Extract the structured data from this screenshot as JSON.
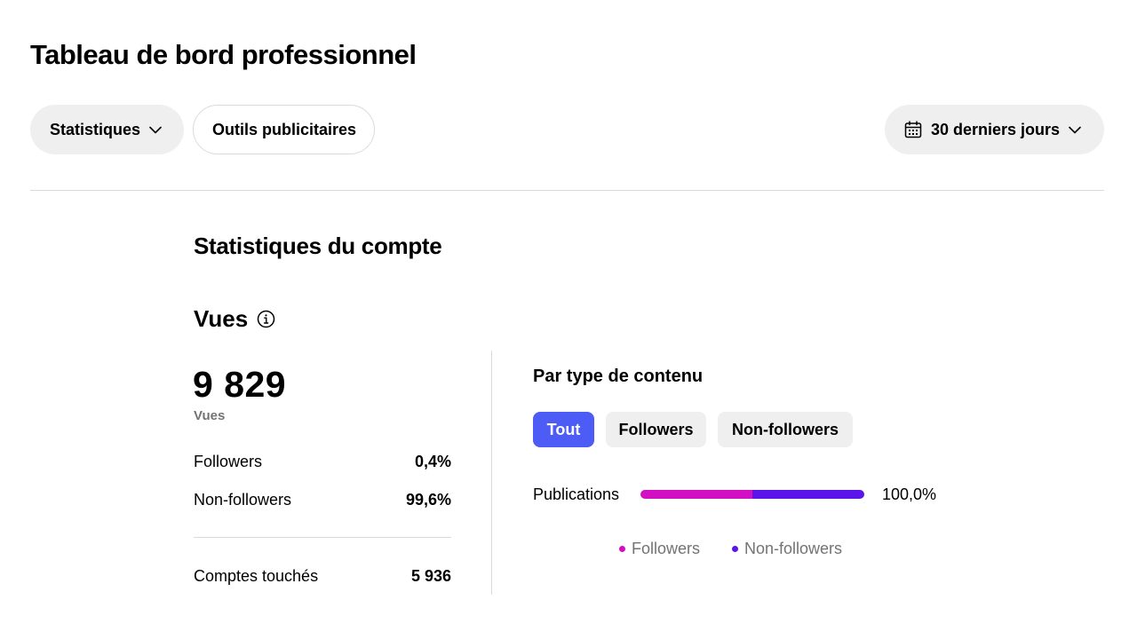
{
  "header": {
    "title": "Tableau de bord professionnel"
  },
  "toolbar": {
    "stats_label": "Statistiques",
    "tools_label": "Outils publicitaires",
    "range_label": "30 derniers jours"
  },
  "main": {
    "section_title": "Statistiques du compte",
    "metric_title": "Vues",
    "total_value": "9 829",
    "total_label": "Vues",
    "rows": [
      {
        "label": "Followers",
        "value": "0,4%"
      },
      {
        "label": "Non-followers",
        "value": "99,6%"
      },
      {
        "label": "Comptes touchés",
        "value": "5 936"
      }
    ]
  },
  "content_type": {
    "title": "Par type de contenu",
    "tabs": [
      {
        "label": "Tout",
        "selected": true
      },
      {
        "label": "Followers",
        "selected": false
      },
      {
        "label": "Non-followers",
        "selected": false
      }
    ],
    "bar": {
      "label": "Publications",
      "value": "100,0%",
      "followers_share": 0.5,
      "nonfollowers_share": 0.5
    },
    "legend": [
      {
        "label": "Followers",
        "color": "#d30fc4"
      },
      {
        "label": "Non-followers",
        "color": "#5b14ea"
      }
    ]
  },
  "colors": {
    "accent": "#4c5cf5",
    "followers": "#d30fc4",
    "nonfollowers": "#5b14ea"
  },
  "icons": {
    "calendar": "calendar-icon",
    "chevron": "chevron-down-icon",
    "info": "info-icon"
  }
}
